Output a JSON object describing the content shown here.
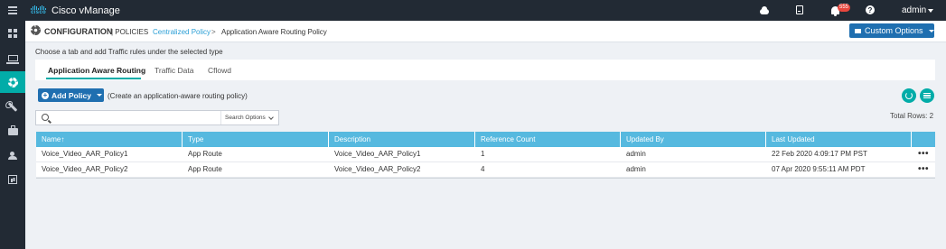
{
  "app": {
    "brand": "cisco",
    "title": "Cisco vManage",
    "notification_count": "555",
    "user": "admin"
  },
  "header": {
    "title": "CONFIGURATION",
    "subtitle": "| POLICIES",
    "breadcrumb_link": "Centralized Policy",
    "breadcrumb_sep": ">",
    "breadcrumb_current": "Application Aware Routing Policy",
    "custom_options": "Custom Options"
  },
  "instruction": "Choose a tab and add Traffic rules under the selected type",
  "tabs": [
    {
      "label": "Application Aware Routing",
      "active": true
    },
    {
      "label": "Traffic Data",
      "active": false
    },
    {
      "label": "Cflowd",
      "active": false
    }
  ],
  "toolbar": {
    "add_label": "Add Policy",
    "add_hint": "(Create an application-aware routing policy)"
  },
  "search": {
    "placeholder": "",
    "options_label": "Search Options",
    "total_rows": "Total Rows: 2"
  },
  "table": {
    "columns": [
      "Name↑",
      "Type",
      "Description",
      "Reference Count",
      "Updated By",
      "Last Updated"
    ],
    "rows": [
      [
        "Voice_Video_AAR_Policy1",
        "App Route",
        "Voice_Video_AAR_Policy1",
        "1",
        "admin",
        "22 Feb 2020 4:09:17 PM PST"
      ],
      [
        "Voice_Video_AAR_Policy2",
        "App Route",
        "Voice_Video_AAR_Policy2",
        "4",
        "admin",
        "07 Apr 2020 9:55:11 AM PDT"
      ]
    ],
    "row_action": "•••"
  },
  "icons": {
    "nav": [
      "dashboard-icon",
      "monitor-icon",
      "gear-icon",
      "wrench-icon",
      "briefcase-icon",
      "users-icon",
      "report-icon"
    ],
    "top": [
      "cloud-icon",
      "clipboard-icon",
      "bell-icon",
      "help-icon"
    ]
  },
  "colors": {
    "topbar": "#222a34",
    "accent_teal": "#02aca8",
    "primary_blue": "#1f6fb0",
    "table_header": "#56b9df",
    "link": "#2b9fd6",
    "badge": "#e8463d"
  }
}
